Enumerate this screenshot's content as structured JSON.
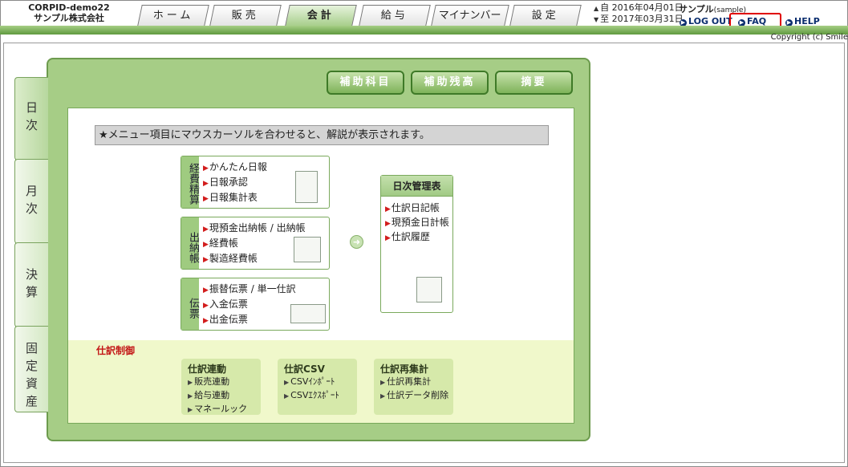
{
  "header": {
    "company_line1": "CORPID-demo22",
    "company_line2": "サンプル株式会社",
    "period_from": "自 2016年04月01日",
    "period_to": "至 2017年03月31日",
    "user_name": "サンプル",
    "user_sub": "(sample)",
    "links": {
      "logout": "LOG OUT",
      "faq": "FAQ",
      "help": "HELP"
    },
    "copyright": "Copyright (c) Smile"
  },
  "tabs": [
    "ホーム",
    "販売",
    "会計",
    "給与",
    "マイナンバー",
    "設定"
  ],
  "active_tab": "会計",
  "side_tabs": [
    "日次",
    "月次",
    "決算",
    "固定資産"
  ],
  "top_buttons": [
    "補助科目",
    "補助残高",
    "摘要"
  ],
  "notice": "★メニュー項目にマウスカーソルを合わせると、解説が表示されます。",
  "cards": [
    {
      "label": "経費精算",
      "items": [
        "かんたん日報",
        "日報承認",
        "日報集計表"
      ]
    },
    {
      "label": "出納帳",
      "items": [
        "現預金出納帳 / 出納帳",
        "経費帳",
        "製造経費帳"
      ]
    },
    {
      "label": "伝票",
      "items": [
        "振替伝票 / 単一仕訳",
        "入金伝票",
        "出金伝票"
      ]
    }
  ],
  "management": {
    "title": "日次管理表",
    "items": [
      "仕訳日記帳",
      "現預金日計帳",
      "仕訳履歴"
    ]
  },
  "journal_control": {
    "title": "仕訳制御",
    "groups": [
      {
        "title": "仕訳連動",
        "items": [
          "販売連動",
          "給与連動",
          "マネールック"
        ]
      },
      {
        "title": "仕訳CSV",
        "items": [
          "CSVｲﾝﾎﾟｰﾄ",
          "CSVｴｸｽﾎﾟｰﾄ"
        ]
      },
      {
        "title": "仕訳再集計",
        "items": [
          "仕訳再集計",
          "仕訳データ削除"
        ]
      }
    ]
  },
  "colors": {
    "accent_green": "#6d9b4e",
    "faq_highlight": "#e00000",
    "link_navy": "#0a2d6e"
  }
}
